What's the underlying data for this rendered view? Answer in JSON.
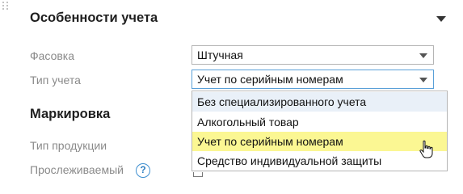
{
  "section_accounting": {
    "title": "Особенности учета"
  },
  "fasovka": {
    "label": "Фасовка",
    "value": "Штучная"
  },
  "tip_ucheta": {
    "label": "Тип учета",
    "value": "Учет по серийным номерам",
    "options": [
      "Без специализированного учета",
      "Алкогольный товар",
      "Учет по серийным номерам",
      "Средство индивидуальной защиты"
    ]
  },
  "section_marking": {
    "title": "Маркировка"
  },
  "tip_produkcii": {
    "label": "Тип продукции"
  },
  "proslezhivaemyi": {
    "label": "Прослеживаемый",
    "help_glyph": "?"
  },
  "colors": {
    "highlight": "#fbf793",
    "hover": "#e9f0f8",
    "focus_border": "#5aa0d8",
    "help": "#3e8fd0"
  }
}
